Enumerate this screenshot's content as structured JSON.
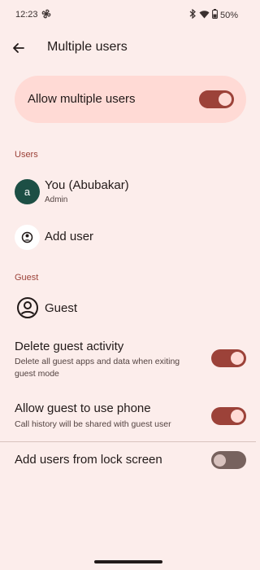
{
  "status": {
    "time": "12:23",
    "battery": "50%"
  },
  "appbar": {
    "title": "Multiple users"
  },
  "master_toggle": {
    "label": "Allow multiple users",
    "state": "on"
  },
  "users_section": {
    "header": "Users",
    "current_user": {
      "initial": "a",
      "name": "You (Abubakar)",
      "role": "Admin"
    },
    "add_user_label": "Add user"
  },
  "guest_section": {
    "header": "Guest",
    "guest_label": "Guest",
    "delete_activity": {
      "title": "Delete guest activity",
      "summary": "Delete all guest apps and data when exiting guest mode",
      "state": "on"
    },
    "allow_phone": {
      "title": "Allow guest to use phone",
      "summary": "Call history will be shared with guest user",
      "state": "on"
    }
  },
  "lock_screen": {
    "title": "Add users from lock screen",
    "state": "off"
  },
  "colors": {
    "accent": "#9c4239",
    "background": "#fcedeb",
    "card": "#ffdad5",
    "avatar": "#1d4f45"
  }
}
